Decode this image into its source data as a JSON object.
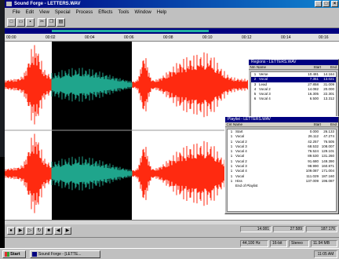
{
  "app": {
    "title": "Sound Forge - LETTERS.WAV"
  },
  "menu": [
    "File",
    "Edit",
    "View",
    "Special",
    "Process",
    "Effects",
    "Tools",
    "Window",
    "Help"
  ],
  "toolbar": {
    "buttons": [
      "new-icon",
      "open-icon",
      "save-icon",
      "cut-icon",
      "copy-icon",
      "paste-icon"
    ]
  },
  "ruler": {
    "ticks": [
      "00:00",
      "00:02",
      "00:04",
      "00:06",
      "00:08",
      "00:10",
      "00:12",
      "00:14",
      "00:16"
    ]
  },
  "colors": {
    "waveform": "#ff2a10",
    "selection_bg": "#000000",
    "selection_wave": "#1fa58c",
    "title_bar": "#000080"
  },
  "regions_dialog": {
    "title": "Regions - LETTERS.WAV",
    "headers": [
      "Nm",
      "Name",
      "Start",
      "End"
    ],
    "rows": [
      {
        "num": "1",
        "name": "Verse",
        "start": "10.481",
        "end": "14.164"
      },
      {
        "num": "2",
        "name": "Vocal",
        "start": "7.351",
        "end": "13.021"
      },
      {
        "num": "3",
        "name": "Lead",
        "start": "27.858",
        "end": "31.009"
      },
      {
        "num": "4",
        "name": "Vocal 2",
        "start": "14.082",
        "end": "20.000"
      },
      {
        "num": "5",
        "name": "Vocal 3",
        "start": "16.305",
        "end": "22.301"
      },
      {
        "num": "6",
        "name": "Vocal 4",
        "start": "6.500",
        "end": "13.312"
      }
    ]
  },
  "playlist_dialog": {
    "title": "Playlist - LETTERS.WAV",
    "headers": [
      "Cnt",
      "Name",
      "Start",
      "End"
    ],
    "rows": [
      {
        "num": "1",
        "name": "Start",
        "start": "0.000",
        "end": "26.133"
      },
      {
        "num": "1",
        "name": "Vocal",
        "start": "26.112",
        "end": "47.274"
      },
      {
        "num": "1",
        "name": "Vocal 2",
        "start": "42.257",
        "end": "76.505"
      },
      {
        "num": "1",
        "name": "Vocal 3",
        "start": "68.532",
        "end": "108.007"
      },
      {
        "num": "1",
        "name": "Vocal 4",
        "start": "76.524",
        "end": "129.101"
      },
      {
        "num": "1",
        "name": "Vocal",
        "start": "89.530",
        "end": "131.260"
      },
      {
        "num": "1",
        "name": "Vocal 2",
        "start": "91.680",
        "end": "149.390"
      },
      {
        "num": "1",
        "name": "Vocal 3",
        "start": "98.990",
        "end": "160.871"
      },
      {
        "num": "1",
        "name": "Vocal 4",
        "start": "109.087",
        "end": "171.004"
      },
      {
        "num": "1",
        "name": "Vocal",
        "start": "111.029",
        "end": "187.160"
      },
      {
        "num": "1",
        "name": "Hiss",
        "start": "137.009",
        "end": "196.087"
      },
      {
        "num": "",
        "name": "End of Playlist",
        "start": "",
        "end": ""
      }
    ]
  },
  "transport": {
    "buttons": [
      "record-icon",
      "play-all-icon",
      "play-icon",
      "loop-icon",
      "stop-icon",
      "rewind-icon",
      "forward-icon"
    ]
  },
  "times": {
    "cursor": "14.081",
    "selection": "27.589",
    "length": "187.176"
  },
  "status": {
    "format": "44,100 Hz",
    "bits": "16-bit",
    "channels": "Stereo",
    "size": "11.94 MB"
  },
  "taskbar": {
    "start": "Start",
    "task": "Sound Forge - [LETTE...",
    "clock": "11:05 AM"
  }
}
